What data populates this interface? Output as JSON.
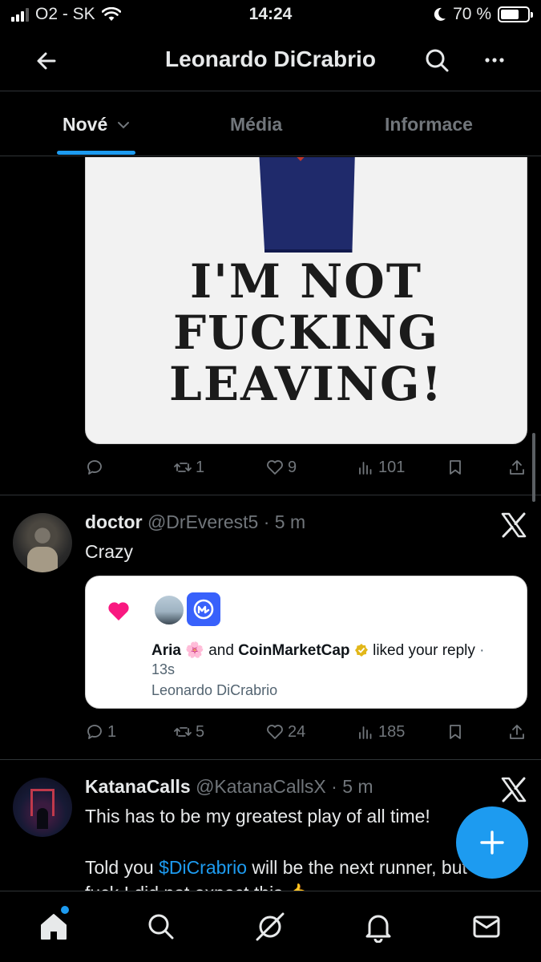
{
  "status_bar": {
    "carrier": "O2 - SK",
    "time": "14:24",
    "battery": "70 %",
    "battery_level": 0.7
  },
  "header": {
    "title": "Leonardo DiCrabrio"
  },
  "tabs": [
    {
      "label": "Nové",
      "active": true
    },
    {
      "label": "Média",
      "active": false
    },
    {
      "label": "Informace",
      "active": false
    }
  ],
  "posts": [
    {
      "image_text": [
        "I'M NOT",
        "FUCKING",
        "LEAVING!"
      ],
      "stats": {
        "replies": "",
        "reposts": "1",
        "likes": "9",
        "views": "101"
      }
    },
    {
      "name": "doctor",
      "handle": "@DrEverest5",
      "time": "5 m",
      "text": "Crazy",
      "quoted_notification": {
        "user1": "Aria",
        "connector": "and",
        "user2": "CoinMarketCap",
        "action": "liked your reply",
        "time": "13s",
        "account": "Leonardo DiCrabrio"
      },
      "stats": {
        "replies": "1",
        "reposts": "5",
        "likes": "24",
        "views": "185"
      }
    },
    {
      "name": "KatanaCalls",
      "handle": "@KatanaCallsX",
      "time": "5 m",
      "line1": "This has to be my greatest play of all time!",
      "line2_prefix": "Told you ",
      "line2_link": "$DiCrabrio",
      "line2_suffix": " will be the next runner, but",
      "line3": "fuck I did not expect this 🤙"
    }
  ],
  "colors": {
    "accent": "#1d9bf0",
    "like_pink": "#f91880"
  }
}
